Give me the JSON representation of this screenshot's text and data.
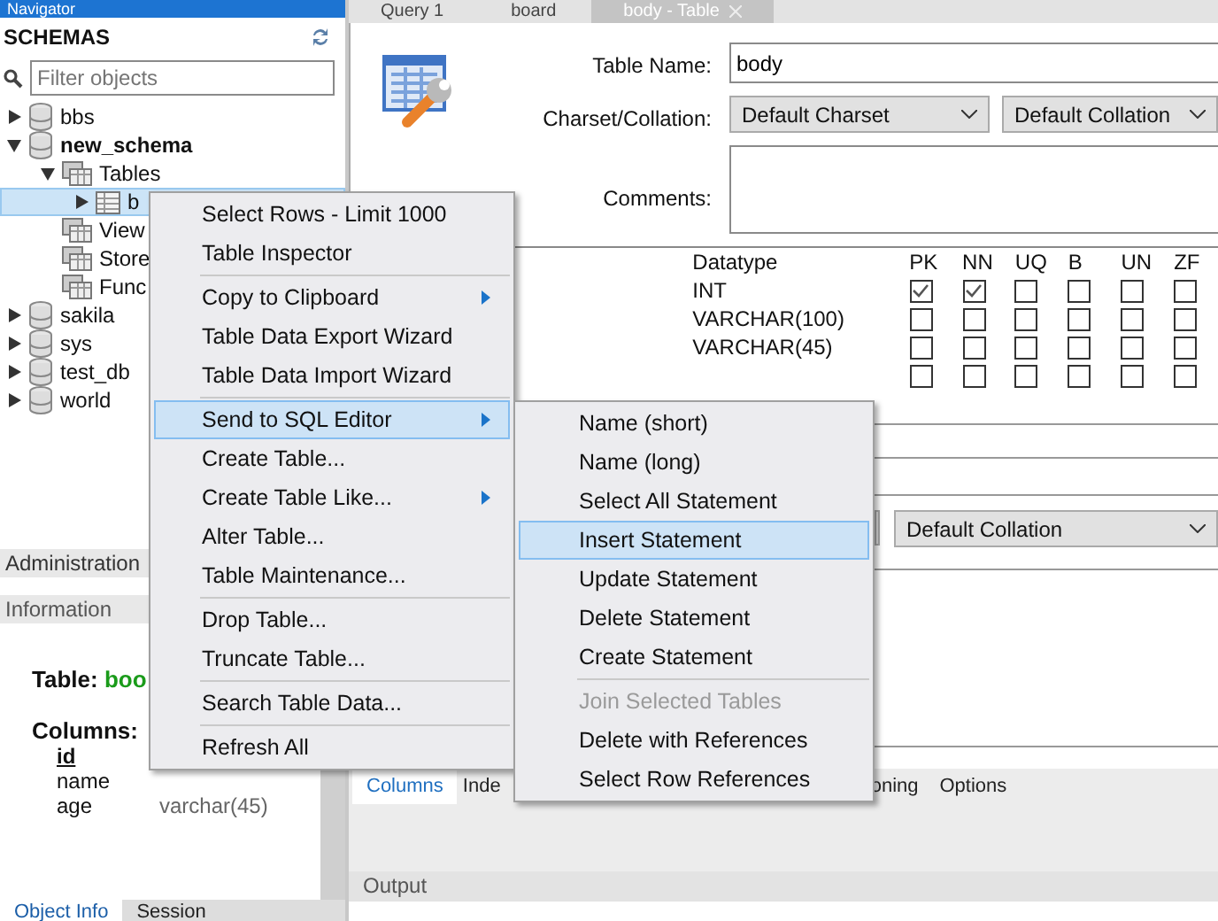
{
  "navigator": {
    "title": "Navigator",
    "schemas_label": "SCHEMAS",
    "filter": {
      "placeholder": "Filter objects"
    },
    "tree": [
      {
        "kind": "schema",
        "label": "bbs",
        "expanded": false,
        "default": false,
        "selected": false
      },
      {
        "kind": "schema",
        "label": "new_schema",
        "expanded": true,
        "default": true,
        "selected": false,
        "children": [
          {
            "kind": "folder",
            "label": "Tables",
            "expanded": true,
            "selected": false,
            "children": [
              {
                "kind": "table",
                "label": "b",
                "expanded": false,
                "selected": true
              }
            ]
          },
          {
            "kind": "folder",
            "label": "View",
            "selected": false
          },
          {
            "kind": "folder",
            "label": "Store",
            "selected": false
          },
          {
            "kind": "folder",
            "label": "Func",
            "selected": false
          }
        ]
      },
      {
        "kind": "schema",
        "label": "sakila",
        "expanded": false,
        "default": false,
        "selected": false
      },
      {
        "kind": "schema",
        "label": "sys",
        "expanded": false,
        "default": false,
        "selected": false
      },
      {
        "kind": "schema",
        "label": "test_db",
        "expanded": false,
        "default": false,
        "selected": false
      },
      {
        "kind": "schema",
        "label": "world",
        "expanded": false,
        "default": false,
        "selected": false
      }
    ]
  },
  "admin_tab": {
    "label": "Administration"
  },
  "information": {
    "title": "Information",
    "table_label": "Table:",
    "table_name": "boo",
    "columns_label": "Columns:",
    "columns": [
      {
        "name": "id",
        "primary": true
      },
      {
        "name": "name",
        "primary": false
      },
      {
        "name": "age",
        "primary": false,
        "type": "varchar(45)"
      }
    ]
  },
  "bottom_tabs": [
    {
      "label": "Object Info",
      "selected": true
    },
    {
      "label": "Session",
      "selected": false
    }
  ],
  "editor_tabs": [
    {
      "label": "Query 1",
      "selected": false
    },
    {
      "label": "board",
      "selected": false
    },
    {
      "label": "body - Table",
      "selected": true
    }
  ],
  "form": {
    "table_name_label": "Table Name:",
    "table_name": "body",
    "charset_label": "Charset/Collation:",
    "charset": "Default Charset",
    "collation": "Default Collation",
    "comments_label": "Comments:"
  },
  "grid": {
    "columns": [
      "Datatype",
      "PK",
      "NN",
      "UQ",
      "B",
      "UN",
      "ZF"
    ],
    "rows": [
      {
        "datatype": "INT",
        "checks": [
          true,
          true,
          false,
          false,
          false,
          false
        ]
      },
      {
        "datatype": "VARCHAR(100)",
        "checks": [
          false,
          false,
          false,
          false,
          false,
          false
        ]
      },
      {
        "datatype": "VARCHAR(45)",
        "checks": [
          false,
          false,
          false,
          false,
          false,
          false
        ]
      },
      {
        "checks": [
          false,
          false,
          false,
          false,
          false,
          false
        ]
      }
    ]
  },
  "details": {
    "collation": "Default Collation"
  },
  "detail_tabs": [
    {
      "label": "Columns",
      "selected": true
    },
    {
      "label": "Inde",
      "selected": false
    },
    {
      "label": "oning",
      "selected": false
    },
    {
      "label": "Options",
      "selected": false
    }
  ],
  "output": {
    "title": "Output"
  },
  "context_menu": [
    {
      "kind": "item",
      "label": "Select Rows - Limit 1000",
      "submenu": false,
      "selected": false
    },
    {
      "kind": "item",
      "label": "Table Inspector",
      "submenu": false,
      "selected": false
    },
    {
      "kind": "separator"
    },
    {
      "kind": "item",
      "label": "Copy to Clipboard",
      "submenu": true,
      "selected": false
    },
    {
      "kind": "item",
      "label": "Table Data Export Wizard",
      "submenu": false,
      "selected": false
    },
    {
      "kind": "item",
      "label": "Table Data Import Wizard",
      "submenu": false,
      "selected": false
    },
    {
      "kind": "separator"
    },
    {
      "kind": "item",
      "label": "Send to SQL Editor",
      "submenu": true,
      "selected": true
    },
    {
      "kind": "item",
      "label": "Create Table...",
      "submenu": false,
      "selected": false
    },
    {
      "kind": "item",
      "label": "Create Table Like...",
      "submenu": true,
      "selected": false
    },
    {
      "kind": "item",
      "label": "Alter Table...",
      "submenu": false,
      "selected": false
    },
    {
      "kind": "item",
      "label": "Table Maintenance...",
      "submenu": false,
      "selected": false
    },
    {
      "kind": "separator"
    },
    {
      "kind": "item",
      "label": "Drop Table...",
      "submenu": false,
      "selected": false
    },
    {
      "kind": "item",
      "label": "Truncate Table...",
      "submenu": false,
      "selected": false
    },
    {
      "kind": "separator"
    },
    {
      "kind": "item",
      "label": "Search Table Data...",
      "submenu": false,
      "selected": false
    },
    {
      "kind": "separator"
    },
    {
      "kind": "item",
      "label": "Refresh All",
      "submenu": false,
      "selected": false
    }
  ],
  "submenu": [
    {
      "kind": "item",
      "label": "Name (short)",
      "selected": false,
      "disabled": false
    },
    {
      "kind": "item",
      "label": "Name (long)",
      "selected": false,
      "disabled": false
    },
    {
      "kind": "item",
      "label": "Select All Statement",
      "selected": false,
      "disabled": false
    },
    {
      "kind": "item",
      "label": "Insert Statement",
      "selected": true,
      "disabled": false
    },
    {
      "kind": "item",
      "label": "Update Statement",
      "selected": false,
      "disabled": false
    },
    {
      "kind": "item",
      "label": "Delete Statement",
      "selected": false,
      "disabled": false
    },
    {
      "kind": "item",
      "label": "Create Statement",
      "selected": false,
      "disabled": false
    },
    {
      "kind": "separator"
    },
    {
      "kind": "item",
      "label": "Join Selected Tables",
      "selected": false,
      "disabled": true
    },
    {
      "kind": "item",
      "label": "Delete with References",
      "selected": false,
      "disabled": false
    },
    {
      "kind": "item",
      "label": "Select Row References",
      "selected": false,
      "disabled": false
    }
  ]
}
